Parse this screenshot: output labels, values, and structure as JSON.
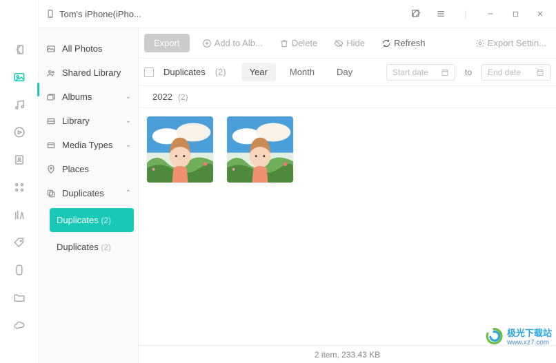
{
  "titlebar": {
    "device_name": "Tom's iPhone(iPho..."
  },
  "icon_rail": {
    "items": [
      {
        "name": "back-icon"
      },
      {
        "name": "photos-icon",
        "active": true
      },
      {
        "name": "music-icon"
      },
      {
        "name": "video-icon"
      },
      {
        "name": "contacts-icon"
      },
      {
        "name": "apps-icon"
      },
      {
        "name": "books-icon"
      },
      {
        "name": "tags-icon"
      },
      {
        "name": "storage-icon"
      },
      {
        "name": "files-icon"
      },
      {
        "name": "icloud-icon"
      }
    ]
  },
  "sidebar": {
    "all_photos": "All Photos",
    "shared_library": "Shared Library",
    "albums": "Albums",
    "library": "Library",
    "media_types": "Media Types",
    "places": "Places",
    "duplicates": "Duplicates",
    "sub_duplicates_active": "Duplicates",
    "sub_duplicates_active_count": "(2)",
    "sub_duplicates_plain": "Duplicates",
    "sub_duplicates_plain_count": "(2)"
  },
  "toolbar": {
    "export": "Export",
    "add_to_album": "Add to Alb...",
    "delete": "Delete",
    "hide": "Hide",
    "refresh": "Refresh",
    "export_settings": "Export Settin..."
  },
  "filter": {
    "label": "Duplicates",
    "count": "(2)",
    "seg_year": "Year",
    "seg_month": "Month",
    "seg_day": "Day",
    "start_placeholder": "Start date",
    "to": "to",
    "end_placeholder": "End date"
  },
  "group": {
    "year": "2022",
    "count": "(2)"
  },
  "status": {
    "text": "2 item, 233.43 KB"
  },
  "watermark": {
    "line1": "极光下载站",
    "line2": "www.xz7.com"
  }
}
